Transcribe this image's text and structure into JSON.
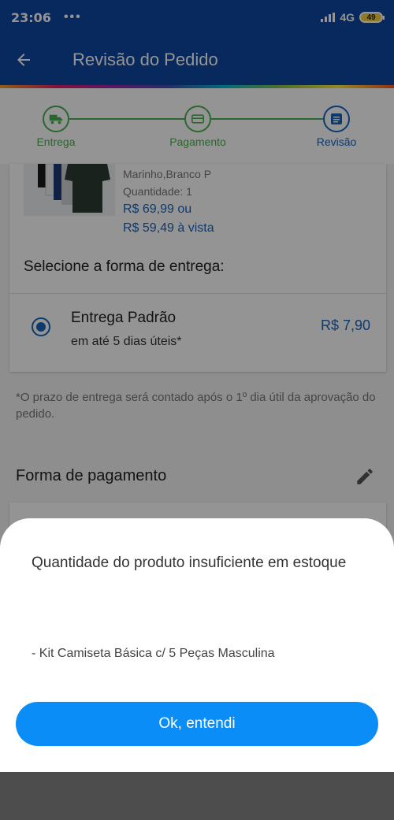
{
  "status_bar": {
    "time": "23:06",
    "dots": "•••",
    "network": "4G",
    "battery": "49"
  },
  "header": {
    "title": "Revisão do Pedido"
  },
  "stepper": {
    "steps": [
      {
        "label": "Entrega",
        "icon": "truck-icon",
        "color": "#4caf50"
      },
      {
        "label": "Pagamento",
        "icon": "card-icon",
        "color": "#4caf50"
      },
      {
        "label": "Revisão",
        "icon": "document-icon",
        "color": "#1565c0"
      }
    ]
  },
  "product": {
    "variant": "Marinho,Branco P",
    "quantity": "Quantidade: 1",
    "price": "R$ 69,99 ou",
    "price_cash": "R$ 59,49 à vista"
  },
  "delivery": {
    "heading": "Selecione a forma de entrega:",
    "option_name": "Entrega Padrão",
    "option_time": "em até 5 dias úteis*",
    "option_price": "R$ 7,90",
    "note": "*O prazo de entrega será contado após o 1º dia útil da aprovação do pedido."
  },
  "payment": {
    "heading": "Forma de pagamento"
  },
  "dialog": {
    "title": "Quantidade do produto insuficiente em estoque",
    "item": "- Kit Camiseta Básica c/ 5 Peças Masculina",
    "ok_label": "Ok, entendi"
  },
  "colors": {
    "primary": "#0d47a1",
    "accent_blue": "#1565c0",
    "button_blue": "#0b8df7",
    "step_green": "#4caf50"
  }
}
